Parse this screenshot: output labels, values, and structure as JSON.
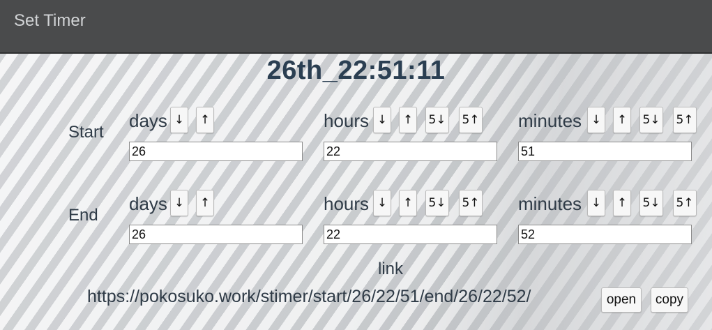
{
  "header": {
    "title": "Set Timer"
  },
  "current_time": "26th_22:51:11",
  "start": {
    "label": "Start",
    "days": {
      "label": "days",
      "value": "26"
    },
    "hours": {
      "label": "hours",
      "value": "22"
    },
    "minutes": {
      "label": "minutes",
      "value": "51"
    }
  },
  "end": {
    "label": "End",
    "days": {
      "label": "days",
      "value": "26"
    },
    "hours": {
      "label": "hours",
      "value": "22"
    },
    "minutes": {
      "label": "minutes",
      "value": "52"
    }
  },
  "buttons": {
    "down": "↓",
    "up": "↑",
    "down5": "5↓",
    "up5": "5↑"
  },
  "link": {
    "label": "link",
    "url": "https://pokosuko.work/stimer/start/26/22/51/end/26/22/52/",
    "open_label": "open",
    "copy_label": "copy"
  }
}
